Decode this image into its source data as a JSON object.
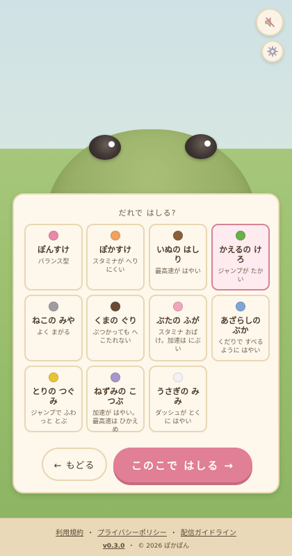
{
  "prompt": "だれで はしる?",
  "characters": [
    {
      "name": "ぽんすけ",
      "desc": "バランス型",
      "color": "#e88aa7",
      "selected": false
    },
    {
      "name": "ぽかすけ",
      "desc": "スタミナが へりにくい",
      "color": "#f0a25e",
      "selected": false
    },
    {
      "name": "いぬの はしり",
      "desc": "最高速が はやい",
      "color": "#8a5e3c",
      "selected": false
    },
    {
      "name": "かえるの けろ",
      "desc": "ジャンプが たかい",
      "color": "#6ab04c",
      "selected": true
    },
    {
      "name": "ねこの みや",
      "desc": "よく まがる",
      "color": "#9e9e9e",
      "selected": false
    },
    {
      "name": "くまの ぐり",
      "desc": "ぶつかっても へこたれない",
      "color": "#6b4a33",
      "selected": false
    },
    {
      "name": "ぶたの ふが",
      "desc": "スタミナ おばけ。加速は にぶい",
      "color": "#f0a6bd",
      "selected": false
    },
    {
      "name": "あざらしの ぶか",
      "desc": "くだりで すべるように はやい",
      "color": "#7ea6d6",
      "selected": false
    },
    {
      "name": "とりの つぐみ",
      "desc": "ジャンプで ふわっと とぶ",
      "color": "#e6c43a",
      "selected": false
    },
    {
      "name": "ねずみの こつぶ",
      "desc": "加速が はやい。最高速は ひかえめ",
      "color": "#a896c9",
      "selected": false
    },
    {
      "name": "うさぎの みみ",
      "desc": "ダッシュが とくに はやい",
      "color": "#f2f2f2",
      "selected": false
    }
  ],
  "buttons": {
    "back": "← もどる",
    "go": "このこで はしる →"
  },
  "footer": {
    "links": [
      "利用規約",
      "プライバシーポリシー",
      "配信ガイドライン"
    ],
    "separator": "・",
    "version": "v0.3.0",
    "copyright": "© 2026 ぽかぽん"
  },
  "colors": {
    "accent": "#e07f95",
    "panel": "#fdf7ec",
    "border": "#e8d7b2",
    "selected_bg": "#fdebef",
    "selected_border": "#d58394"
  },
  "icons": {
    "mute": "speaker-muted-icon",
    "settings": "gear-icon"
  }
}
